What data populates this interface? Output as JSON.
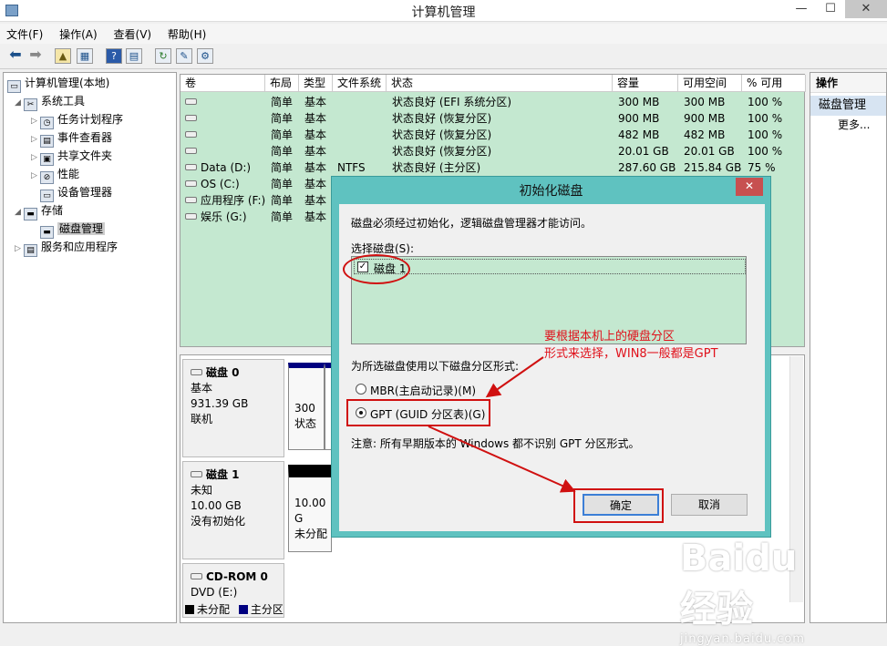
{
  "window": {
    "title": "计算机管理",
    "minimize": "—",
    "maximize": "☐",
    "close": "✕"
  },
  "menu": [
    "文件(F)",
    "操作(A)",
    "查看(V)",
    "帮助(H)"
  ],
  "toolbar_icons": [
    "back-icon",
    "forward-icon",
    "up-folder-icon",
    "show-hide-tree-icon",
    "help-icon",
    "properties-icon",
    "refresh-icon",
    "export-icon",
    "settings-icon"
  ],
  "tree": [
    {
      "label": "计算机管理(本地)",
      "level": 0,
      "arrow": ""
    },
    {
      "label": "系统工具",
      "level": 1,
      "arrow": "◢"
    },
    {
      "label": "任务计划程序",
      "level": 2,
      "arrow": "▷"
    },
    {
      "label": "事件查看器",
      "level": 2,
      "arrow": "▷"
    },
    {
      "label": "共享文件夹",
      "level": 2,
      "arrow": "▷"
    },
    {
      "label": "性能",
      "level": 2,
      "arrow": "▷"
    },
    {
      "label": "设备管理器",
      "level": 2,
      "arrow": ""
    },
    {
      "label": "存储",
      "level": 1,
      "arrow": "◢"
    },
    {
      "label": "磁盘管理",
      "level": 2,
      "arrow": ""
    },
    {
      "label": "服务和应用程序",
      "level": 1,
      "arrow": "▷"
    }
  ],
  "columns": [
    "卷",
    "布局",
    "类型",
    "文件系统",
    "状态",
    "容量",
    "可用空间",
    "% 可用"
  ],
  "volumes": [
    [
      "",
      "简单",
      "基本",
      "",
      "状态良好 (EFI 系统分区)",
      "300 MB",
      "300 MB",
      "100 %"
    ],
    [
      "",
      "简单",
      "基本",
      "",
      "状态良好 (恢复分区)",
      "900 MB",
      "900 MB",
      "100 %"
    ],
    [
      "",
      "简单",
      "基本",
      "",
      "状态良好 (恢复分区)",
      "482 MB",
      "482 MB",
      "100 %"
    ],
    [
      "",
      "简单",
      "基本",
      "",
      "状态良好 (恢复分区)",
      "20.01 GB",
      "20.01 GB",
      "100 %"
    ],
    [
      "Data (D:)",
      "简单",
      "基本",
      "NTFS",
      "状态良好 (主分区)",
      "287.60 GB",
      "215.84 GB",
      "75 %"
    ],
    [
      "OS (C:)",
      "简单",
      "基本",
      "",
      "",
      "",
      "",
      "%"
    ],
    [
      "应用程序 (F:)",
      "简单",
      "基本",
      "",
      "",
      "",
      "",
      "%"
    ],
    [
      "娱乐 (G:)",
      "简单",
      "基本",
      "",
      "",
      "",
      "",
      "%"
    ]
  ],
  "disks": [
    {
      "name": "磁盘 0",
      "type": "基本",
      "size": "931.39 GB",
      "status": "联机",
      "part_size": "300",
      "part_status": "状态"
    },
    {
      "name": "磁盘 1",
      "type": "未知",
      "size": "10.00 GB",
      "status": "没有初始化",
      "part_size": "10.00 G",
      "part_status": "未分配"
    },
    {
      "name": "CD-ROM 0",
      "type": "DVD (E:)",
      "size": "",
      "status": "",
      "part_size": "",
      "part_status": ""
    }
  ],
  "legend": {
    "unallocated": "未分配",
    "primary": "主分区",
    "unallocated_color": "#000000",
    "primary_color": "#000080"
  },
  "actions": {
    "header": "操作",
    "selected": "磁盘管理",
    "more": "更多..."
  },
  "dialog": {
    "title": "初始化磁盘",
    "message": "磁盘必须经过初始化，逻辑磁盘管理器才能访问。",
    "select_label": "选择磁盘(S):",
    "disk_item": "磁盘 1",
    "style_label": "为所选磁盘使用以下磁盘分区形式:",
    "mbr": "MBR(主启动记录)(M)",
    "gpt": "GPT (GUID 分区表)(G)",
    "note": "注意: 所有早期版本的 Windows 都不识别 GPT 分区形式。",
    "ok": "确定",
    "cancel": "取消"
  },
  "annotation": {
    "line1": "要根据本机上的硬盘分区",
    "line2": "形式来选择，WIN8一般都是GPT",
    "color": "#e0101a"
  },
  "watermark": {
    "logo": "Baidu 经验",
    "url": "jingyan.baidu.com"
  }
}
